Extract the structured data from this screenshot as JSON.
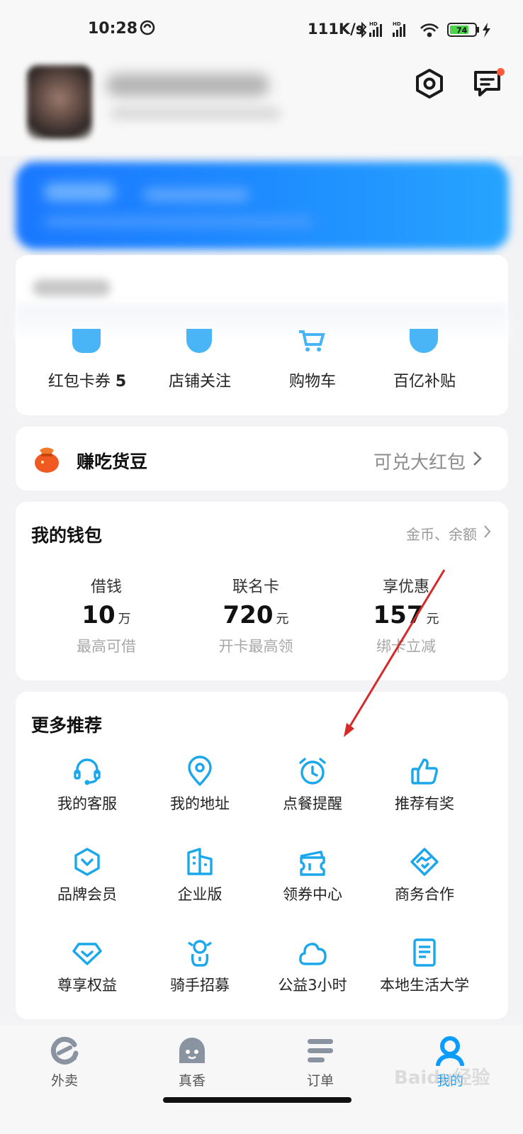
{
  "status_bar": {
    "time": "10:28",
    "net_speed": "111K/s",
    "battery": "74"
  },
  "colors": {
    "accent": "#0a9cff",
    "icon_blue": "#1aa7ec",
    "muted": "#9a9a9a"
  },
  "header": {
    "settings_icon": "settings-icon",
    "message_icon": "message-icon"
  },
  "quick_links": [
    {
      "label": "红包卡券",
      "count": "5"
    },
    {
      "label": "店铺关注"
    },
    {
      "label": "购物车"
    },
    {
      "label": "百亿补贴"
    }
  ],
  "beans": {
    "title": "赚吃货豆",
    "right_text": "可兑大红包"
  },
  "wallet": {
    "title": "我的钱包",
    "link": "金币、余额",
    "items": [
      {
        "label": "借钱",
        "value": "10",
        "unit": "万",
        "desc": "最高可借"
      },
      {
        "label": "联名卡",
        "value": "720",
        "unit": "元",
        "desc": "开卡最高领"
      },
      {
        "label": "享优惠",
        "value": "157",
        "unit": "元",
        "desc": "绑卡立减"
      }
    ]
  },
  "more": {
    "title": "更多推荐",
    "items": [
      {
        "label": "我的客服",
        "icon": "headset-icon"
      },
      {
        "label": "我的地址",
        "icon": "location-pin-icon"
      },
      {
        "label": "点餐提醒",
        "icon": "alarm-clock-icon"
      },
      {
        "label": "推荐有奖",
        "icon": "thumbs-up-icon"
      },
      {
        "label": "品牌会员",
        "icon": "brand-hexagon-icon"
      },
      {
        "label": "企业版",
        "icon": "building-icon"
      },
      {
        "label": "领券中心",
        "icon": "ticket-icon"
      },
      {
        "label": "商务合作",
        "icon": "handshake-icon"
      },
      {
        "label": "尊享权益",
        "icon": "diamond-icon"
      },
      {
        "label": "骑手招募",
        "icon": "rider-icon"
      },
      {
        "label": "公益3小时",
        "icon": "cloud-heart-icon"
      },
      {
        "label": "本地生活大学",
        "icon": "notebook-icon"
      }
    ]
  },
  "tabs": [
    {
      "label": "外卖",
      "icon": "eleme-logo-icon"
    },
    {
      "label": "真香",
      "icon": "ghost-face-icon"
    },
    {
      "label": "订单",
      "icon": "list-icon"
    },
    {
      "label": "我的",
      "icon": "user-icon",
      "active": true
    }
  ],
  "watermark": "Baidu经验"
}
